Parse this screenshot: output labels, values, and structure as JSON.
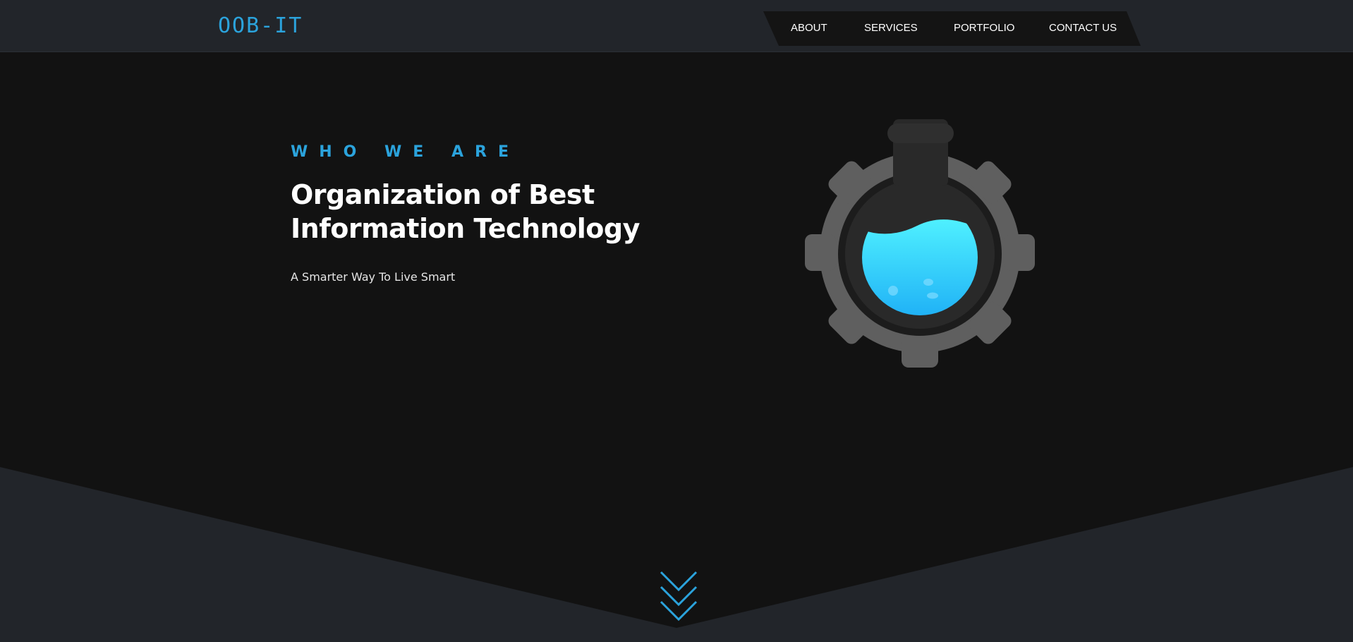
{
  "header": {
    "logo": "OOB-IT",
    "nav": [
      {
        "label": "ABOUT"
      },
      {
        "label": "SERVICES"
      },
      {
        "label": "PORTFOLIO"
      },
      {
        "label": "CONTACT US"
      }
    ]
  },
  "hero": {
    "eyebrow": "WHO WE ARE",
    "headline_line1": "Organization of Best",
    "headline_line2": "Information Technology",
    "tagline": "A Smarter Way To Live Smart",
    "illustration_icon": "gear-flask-icon",
    "scroll_icon": "triple-chevron-down-icon"
  },
  "colors": {
    "accent": "#2ba3dc",
    "header_bg": "#22252a",
    "nav_bg": "#141414",
    "hero_bg": "#121212",
    "lower_bg": "#22252a",
    "gear": "#5f5f5f",
    "liquid_top": "#4ff0ff",
    "liquid_bottom": "#1aaaf5"
  }
}
